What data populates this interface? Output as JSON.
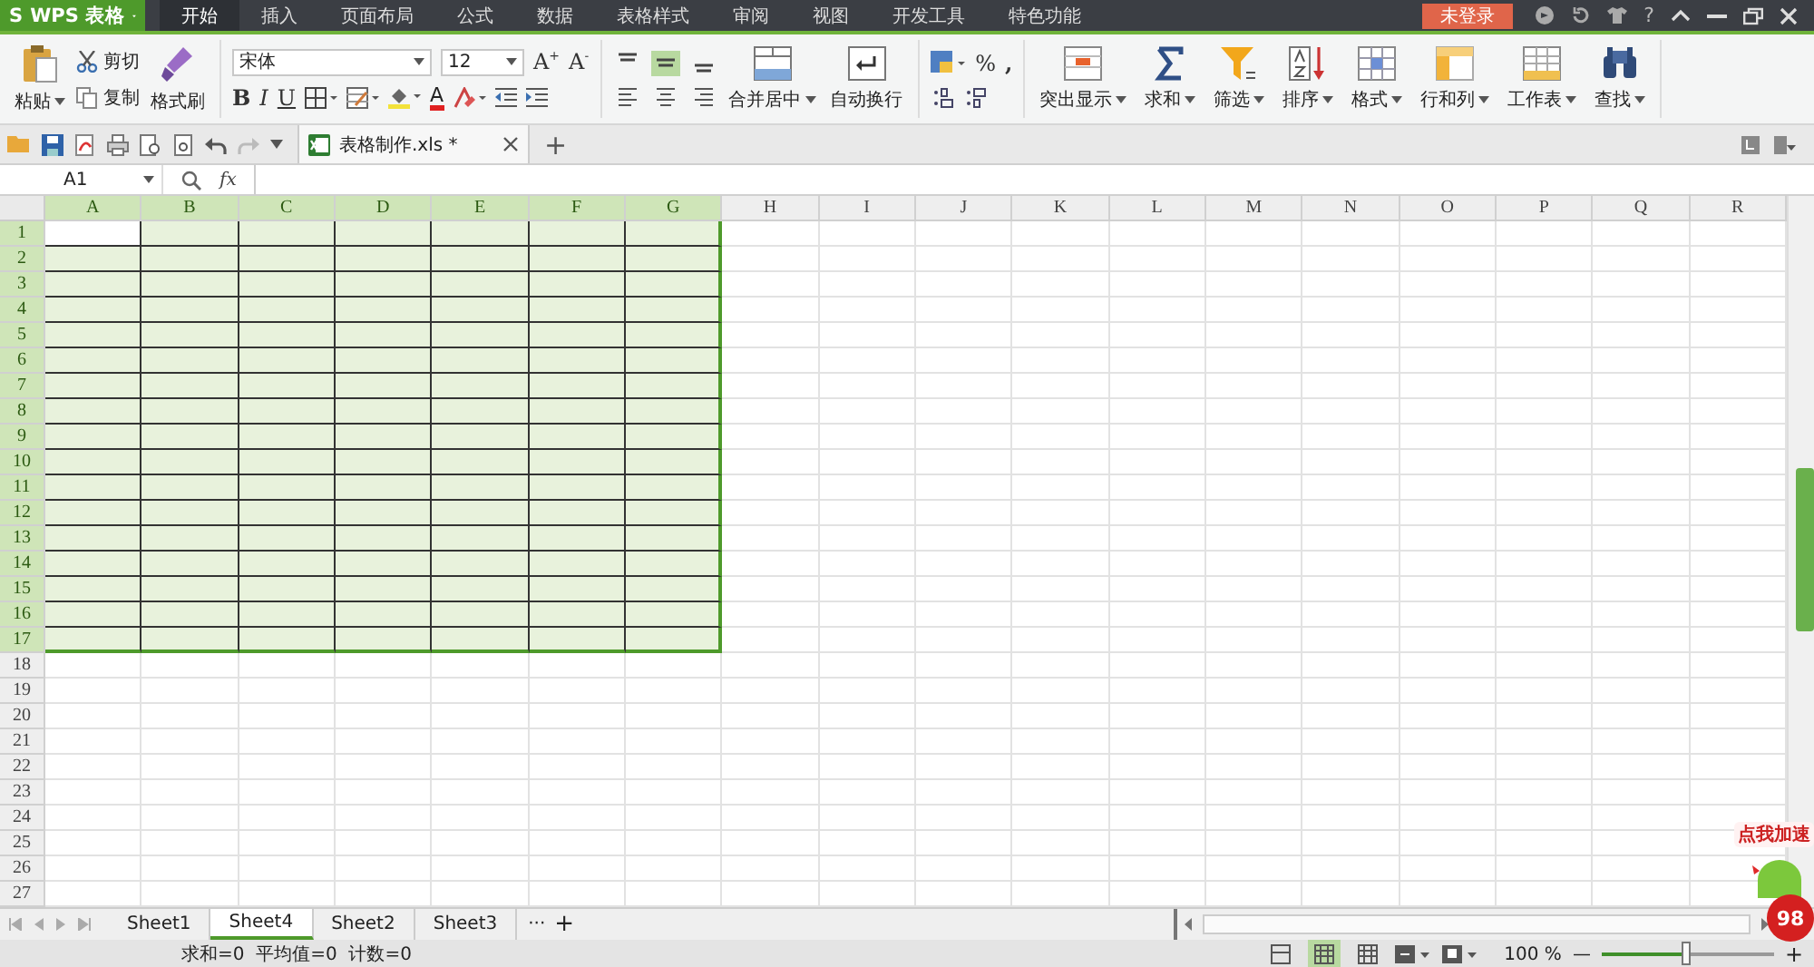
{
  "app": {
    "logo": "S",
    "name": "WPS 表格"
  },
  "menu_tabs": [
    {
      "label": "开始",
      "selected": true
    },
    {
      "label": "插入",
      "selected": false
    },
    {
      "label": "页面布局",
      "selected": false
    },
    {
      "label": "公式",
      "selected": false
    },
    {
      "label": "数据",
      "selected": false
    },
    {
      "label": "表格样式",
      "selected": false
    },
    {
      "label": "审阅",
      "selected": false
    },
    {
      "label": "视图",
      "selected": false
    },
    {
      "label": "开发工具",
      "selected": false
    },
    {
      "label": "特色功能",
      "selected": false
    }
  ],
  "login_button": "未登录",
  "help": "?",
  "ribbon": {
    "clipboard": {
      "paste": "粘贴",
      "cut": "剪切",
      "copy": "复制",
      "format_painter": "格式刷"
    },
    "font": {
      "name": "宋体",
      "size": "12",
      "grow": "A$^{+}$",
      "shrink": "A$^{-}$",
      "bold": "B",
      "italic": "I",
      "underline": "U",
      "font_color": "A"
    },
    "alignment": {
      "vertical": [
        {
          "selected": false
        },
        {
          "selected": true
        },
        {
          "selected": false
        }
      ],
      "merge": "合并居中",
      "wrap": "自动换行"
    },
    "number": {
      "percent": "%",
      "thousands": ","
    },
    "tools": [
      {
        "label": "突出显示",
        "kind": "highlight"
      },
      {
        "label": "求和",
        "kind": "sum"
      },
      {
        "label": "筛选",
        "kind": "filter"
      },
      {
        "label": "排序",
        "kind": "sort"
      },
      {
        "label": "格式",
        "kind": "format"
      },
      {
        "label": "行和列",
        "kind": "rowcol"
      },
      {
        "label": "工作表",
        "kind": "sheet"
      },
      {
        "label": "查找",
        "kind": "find"
      }
    ]
  },
  "document_tab": {
    "title": "表格制作.xls *",
    "new_tab": "+"
  },
  "formula_bar": {
    "name_box": "A1",
    "fx": "fx"
  },
  "columns": [
    {
      "label": "A",
      "selected": true
    },
    {
      "label": "B",
      "selected": true
    },
    {
      "label": "C",
      "selected": true
    },
    {
      "label": "D",
      "selected": true
    },
    {
      "label": "E",
      "selected": true
    },
    {
      "label": "F",
      "selected": true
    },
    {
      "label": "G",
      "selected": true
    },
    {
      "label": "H",
      "selected": false
    },
    {
      "label": "I",
      "selected": false
    },
    {
      "label": "J",
      "selected": false
    },
    {
      "label": "K",
      "selected": false
    },
    {
      "label": "L",
      "selected": false
    },
    {
      "label": "M",
      "selected": false
    },
    {
      "label": "N",
      "selected": false
    },
    {
      "label": "O",
      "selected": false
    },
    {
      "label": "P",
      "selected": false
    },
    {
      "label": "Q",
      "selected": false
    },
    {
      "label": "R",
      "selected": false
    }
  ],
  "rows": [
    {
      "label": "1",
      "selected": true
    },
    {
      "label": "2",
      "selected": true
    },
    {
      "label": "3",
      "selected": true
    },
    {
      "label": "4",
      "selected": true
    },
    {
      "label": "5",
      "selected": true
    },
    {
      "label": "6",
      "selected": true
    },
    {
      "label": "7",
      "selected": true
    },
    {
      "label": "8",
      "selected": true
    },
    {
      "label": "9",
      "selected": true
    },
    {
      "label": "10",
      "selected": true
    },
    {
      "label": "11",
      "selected": true
    },
    {
      "label": "12",
      "selected": true
    },
    {
      "label": "13",
      "selected": true
    },
    {
      "label": "14",
      "selected": true
    },
    {
      "label": "15",
      "selected": true
    },
    {
      "label": "16",
      "selected": true
    },
    {
      "label": "17",
      "selected": true
    },
    {
      "label": "18",
      "selected": false
    },
    {
      "label": "19",
      "selected": false
    },
    {
      "label": "20",
      "selected": false
    },
    {
      "label": "21",
      "selected": false
    },
    {
      "label": "22",
      "selected": false
    },
    {
      "label": "23",
      "selected": false
    },
    {
      "label": "24",
      "selected": false
    },
    {
      "label": "25",
      "selected": false
    },
    {
      "label": "26",
      "selected": false
    },
    {
      "label": "27",
      "selected": false
    }
  ],
  "sheet_tabs": [
    {
      "label": "Sheet1",
      "selected": false
    },
    {
      "label": "Sheet4",
      "selected": true
    },
    {
      "label": "Sheet2",
      "selected": false
    },
    {
      "label": "Sheet3",
      "selected": false
    }
  ],
  "sheet_more": "···",
  "sheet_add": "+",
  "status_bar": {
    "summary": "求和=0  平均值=0  计数=0",
    "views": [
      {
        "selected": false
      },
      {
        "selected": true
      },
      {
        "selected": false
      }
    ],
    "zoom": "100 %",
    "zoom_out": "—",
    "zoom_in": "+",
    "zoom_slider": {
      "level": 0.5
    }
  },
  "speed_widget": {
    "label": "点我加速",
    "badge": "98"
  }
}
